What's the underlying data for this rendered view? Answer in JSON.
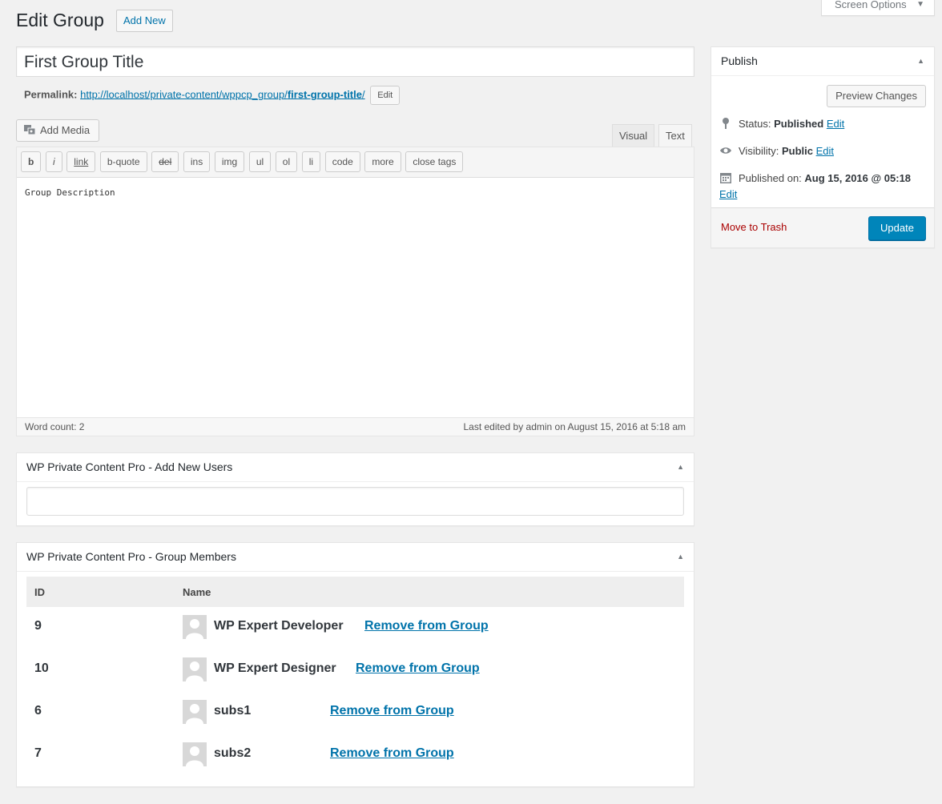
{
  "header": {
    "title": "Edit Group",
    "add_new_label": "Add New",
    "screen_options_label": "Screen Options"
  },
  "post": {
    "title_value": "First Group Title",
    "permalink_label": "Permalink:",
    "permalink_base": "http://localhost/private-content/wppcp_group/",
    "permalink_slug": "first-group-title",
    "permalink_trailing": "/",
    "permalink_edit_label": "Edit"
  },
  "editor": {
    "add_media_label": "Add Media",
    "tabs": [
      "Visual",
      "Text"
    ],
    "active_tab": "Text",
    "quicktags": [
      "b",
      "i",
      "link",
      "b-quote",
      "del",
      "ins",
      "img",
      "ul",
      "ol",
      "li",
      "code",
      "more",
      "close tags"
    ],
    "content": "Group Description",
    "word_count": "Word count: 2",
    "last_edited": "Last edited by admin on August 15, 2016 at 5:18 am"
  },
  "add_users_box": {
    "title": "WP Private Content Pro - Add New Users",
    "input_value": ""
  },
  "members_box": {
    "title": "WP Private Content Pro - Group Members",
    "columns": [
      "ID",
      "Name"
    ],
    "remove_label": "Remove from Group",
    "rows": [
      {
        "id": "9",
        "name": "WP Expert Developer"
      },
      {
        "id": "10",
        "name": "WP Expert Designer"
      },
      {
        "id": "6",
        "name": "subs1"
      },
      {
        "id": "7",
        "name": "subs2"
      }
    ]
  },
  "publish": {
    "title": "Publish",
    "preview_label": "Preview Changes",
    "status_label": "Status:",
    "status_value": "Published",
    "visibility_label": "Visibility:",
    "visibility_value": "Public",
    "published_label": "Published on:",
    "published_value": "Aug 15, 2016 @ 05:18",
    "edit_label": "Edit",
    "trash_label": "Move to Trash",
    "update_label": "Update",
    "accent_color": "#0085ba",
    "trash_color": "#aa0000"
  }
}
